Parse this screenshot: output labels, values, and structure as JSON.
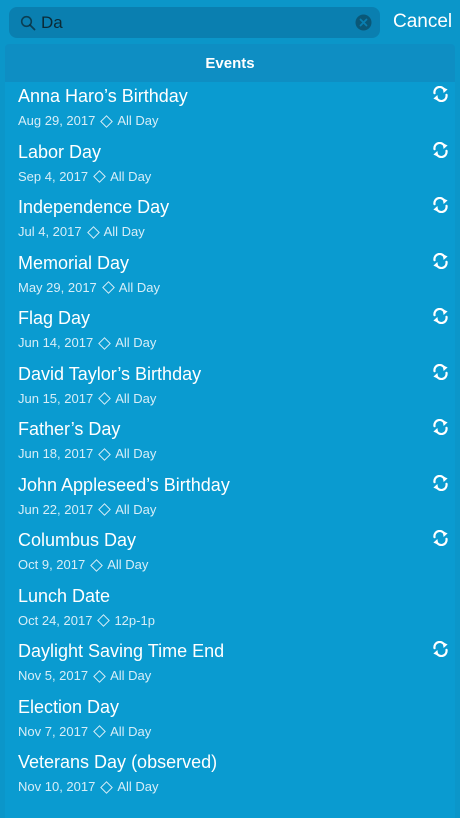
{
  "search": {
    "value": "Da",
    "cancel_label": "Cancel"
  },
  "section": {
    "title": "Events"
  },
  "events": [
    {
      "title": "Anna Haro’s Birthday",
      "date": "Aug 29, 2017",
      "time": "All Day",
      "recurring": true
    },
    {
      "title": "Labor Day",
      "date": "Sep 4, 2017",
      "time": "All Day",
      "recurring": true
    },
    {
      "title": "Independence Day",
      "date": "Jul 4, 2017",
      "time": "All Day",
      "recurring": true
    },
    {
      "title": "Memorial Day",
      "date": "May 29, 2017",
      "time": "All Day",
      "recurring": true
    },
    {
      "title": "Flag Day",
      "date": "Jun 14, 2017",
      "time": "All Day",
      "recurring": true
    },
    {
      "title": "David Taylor’s Birthday",
      "date": "Jun 15, 2017",
      "time": "All Day",
      "recurring": true
    },
    {
      "title": "Father’s Day",
      "date": "Jun 18, 2017",
      "time": "All Day",
      "recurring": true
    },
    {
      "title": "John Appleseed’s Birthday",
      "date": "Jun 22, 2017",
      "time": "All Day",
      "recurring": true
    },
    {
      "title": "Columbus Day",
      "date": "Oct 9, 2017",
      "time": "All Day",
      "recurring": true
    },
    {
      "title": "Lunch Date",
      "date": "Oct 24, 2017",
      "time": "12p-1p",
      "recurring": false
    },
    {
      "title": "Daylight Saving Time End",
      "date": "Nov 5, 2017",
      "time": "All Day",
      "recurring": true
    },
    {
      "title": "Election Day",
      "date": "Nov 7, 2017",
      "time": "All Day",
      "recurring": false
    },
    {
      "title": "Veterans Day (observed)",
      "date": "Nov 10, 2017",
      "time": "All Day",
      "recurring": false
    }
  ],
  "icons": {
    "search": "search-icon",
    "clear": "clear-icon",
    "repeat": "repeat-icon"
  },
  "colors": {
    "background": "#0b96c9",
    "search_field": "#0a7fb0",
    "section_header": "#0e8ec3",
    "text": "#ffffff",
    "subtext": "#d7eef8"
  }
}
